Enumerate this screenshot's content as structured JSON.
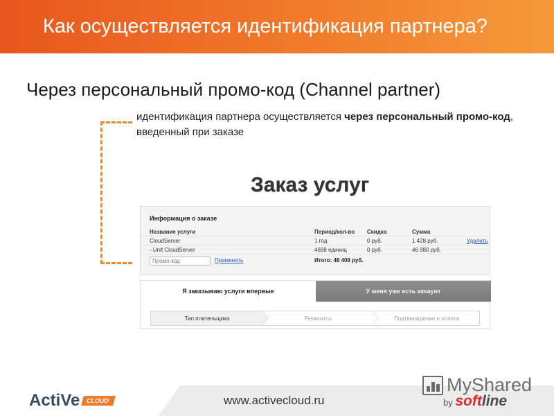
{
  "slide": {
    "title": "Как осуществляется идентификация партнера?",
    "subtitle": "Через персональный промо-код (Channel partner)",
    "description": {
      "part1": "идентификация партнера осуществляется ",
      "bold": "через персональный промо-код",
      "part2": ", введенный при заказе"
    }
  },
  "order": {
    "heading": "Заказ услуг",
    "panel_title": "Информация о заказе",
    "columns": [
      "Название услуги",
      "Период/кол-во",
      "Скидка",
      "Сумма"
    ],
    "rows": [
      {
        "name": "CloudServer",
        "period": "1 год",
        "discount": "0 руб.",
        "sum": "1 428 руб.",
        "action": "Удалить"
      },
      {
        "name": "- Unit CloudServer",
        "period": "4698 единиц",
        "discount": "0 руб.",
        "sum": "46 980 руб.",
        "action": ""
      }
    ],
    "promo_placeholder": "Промо-код",
    "apply_label": "Применить",
    "total": "Итого: 48 408 руб."
  },
  "tabs": {
    "new_customer": "Я заказываю услуги впервые",
    "existing_account": "У меня уже есть аккаунт"
  },
  "steps": [
    "Тип плательщика",
    "Реквизиты",
    "Подтверждение и оплата"
  ],
  "footer": {
    "logo_active": "ActiVe",
    "logo_cloud": "CLOUD",
    "url": "www.activecloud.ru"
  },
  "watermark": {
    "myshared": "MyShared",
    "by": "by",
    "soft": "soft",
    "line": "line"
  },
  "colors": {
    "accent_orange": "#f07a2a",
    "link_blue": "#2a5db0",
    "tab_inactive": "#858585"
  }
}
